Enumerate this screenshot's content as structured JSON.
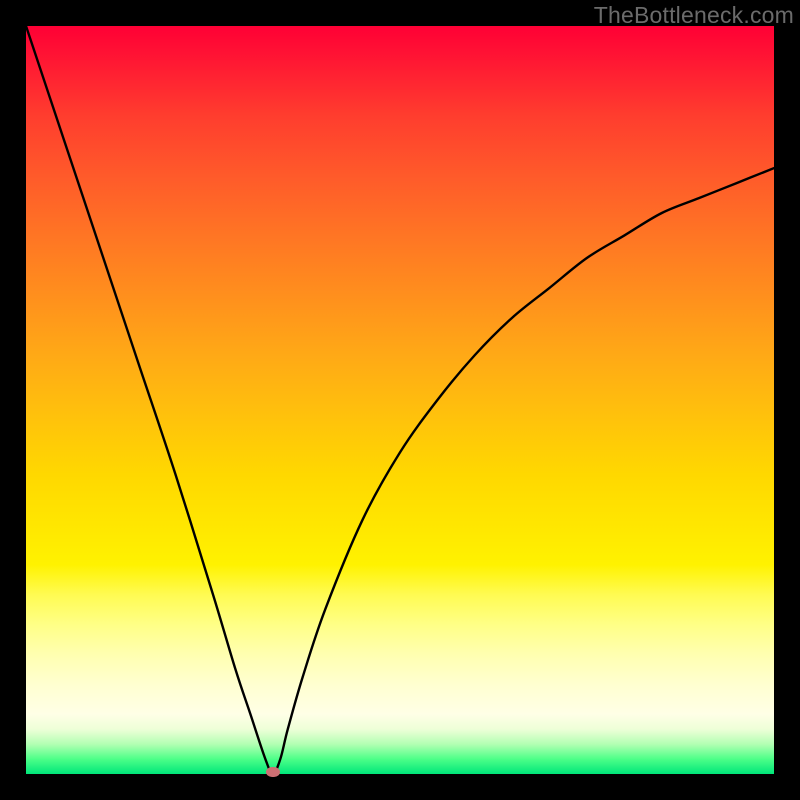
{
  "watermark": "TheBottleneck.com",
  "colors": {
    "frame": "#000000",
    "curve": "#000000",
    "marker": "#cc6f73",
    "gradient_top": "#ff0035",
    "gradient_bottom": "#00e67a"
  },
  "chart_data": {
    "type": "line",
    "title": "",
    "xlabel": "",
    "ylabel": "",
    "xlim": [
      0,
      100
    ],
    "ylim": [
      0,
      100
    ],
    "x": [
      0,
      5,
      10,
      15,
      20,
      25,
      28,
      30,
      32,
      33,
      34,
      35,
      37,
      40,
      45,
      50,
      55,
      60,
      65,
      70,
      75,
      80,
      85,
      90,
      95,
      100
    ],
    "values": [
      100,
      85,
      70,
      55,
      40,
      24,
      14,
      8,
      2,
      0,
      2,
      6,
      13,
      22,
      34,
      43,
      50,
      56,
      61,
      65,
      69,
      72,
      75,
      77,
      79,
      81
    ],
    "minimum_marker": {
      "x": 33,
      "y": 0
    },
    "series": [
      {
        "name": "curve",
        "x_ref": "x",
        "y_ref": "values"
      }
    ]
  }
}
